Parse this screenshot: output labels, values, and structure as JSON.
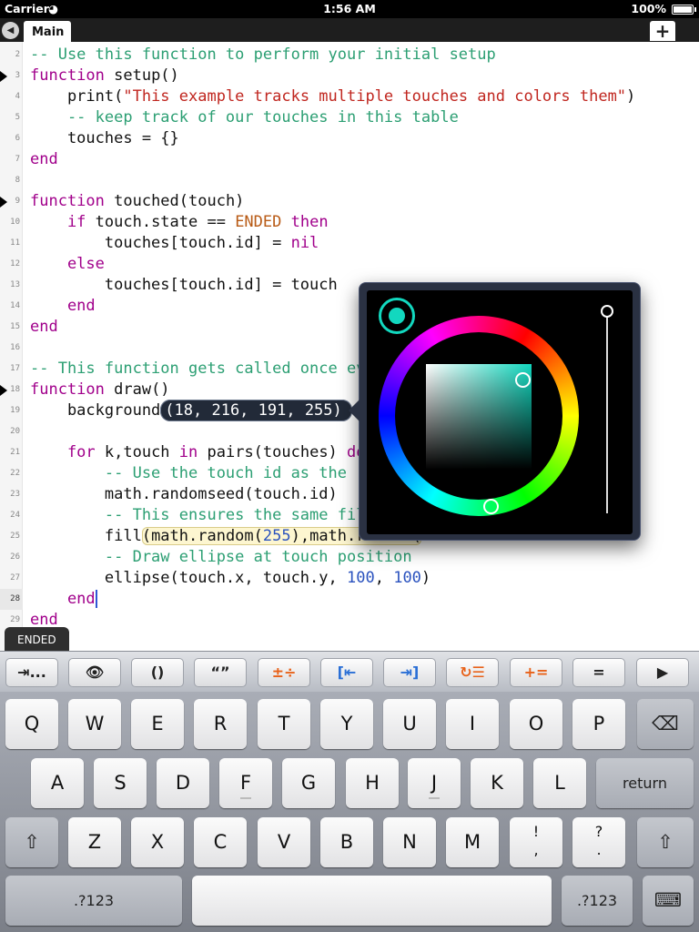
{
  "status_bar": {
    "carrier": "Carrier",
    "wifi_icon": "◕",
    "time": "1:56 AM",
    "battery": "100%"
  },
  "tabs": {
    "back_icon": "◀",
    "active_tab": "Main",
    "add_label": "+"
  },
  "lines": [
    {
      "n": "2"
    },
    {
      "n": "3",
      "bp": true
    },
    {
      "n": "4"
    },
    {
      "n": "5"
    },
    {
      "n": "6"
    },
    {
      "n": "7"
    },
    {
      "n": "8"
    },
    {
      "n": "9",
      "bp": true
    },
    {
      "n": "10"
    },
    {
      "n": "11"
    },
    {
      "n": "12"
    },
    {
      "n": "13"
    },
    {
      "n": "14"
    },
    {
      "n": "15"
    },
    {
      "n": "16"
    },
    {
      "n": "17"
    },
    {
      "n": "18",
      "bp": true
    },
    {
      "n": "19"
    },
    {
      "n": "20"
    },
    {
      "n": "21"
    },
    {
      "n": "22"
    },
    {
      "n": "23"
    },
    {
      "n": "24"
    },
    {
      "n": "25"
    },
    {
      "n": "26"
    },
    {
      "n": "27"
    },
    {
      "n": "28",
      "active": true
    },
    {
      "n": "29"
    }
  ],
  "code": {
    "l2": "-- Use this function to perform your initial setup",
    "l3_kw": "function",
    "l3": " setup()",
    "l4_a": "    print(",
    "l4_str": "\"This example tracks multiple touches and colors them\"",
    "l4_b": ")",
    "l5": "    -- keep track of our touches in this table",
    "l6": "    touches = {}",
    "l7": "end",
    "l9_kw": "function",
    "l9": " touched(touch)",
    "l10_if": "    if",
    "l10_a": " touch.state == ",
    "l10_const": "ENDED",
    "l10_then": " then",
    "l11_a": "        touches[touch.id] = ",
    "l11_nil": "nil",
    "l12": "    else",
    "l13": "        touches[touch.id] = touch",
    "l14": "    end",
    "l15": "end",
    "l17": "-- This function gets called once ev",
    "l18_kw": "function",
    "l18": " draw()",
    "l19_a": "    background",
    "l19_tuple": "(18, 216, 191, 255)",
    "l21_for": "    for",
    "l21_a": " k,touch ",
    "l21_in": "in",
    "l21_b": " pairs(touches) ",
    "l21_do": "do",
    "l22": "        -- Use the touch id as the r",
    "l23": "        math.randomseed(touch.id)",
    "l24": "        -- This ensures the same fil",
    "l25_a": "        fill",
    "l25_hl_a": "(math.random(",
    "l25_num": "255",
    "l25_hl_b": "),math.random(",
    "l26": "        -- Draw ellipse at touch position",
    "l27_a": "        ellipse(touch.x, touch.y, ",
    "l27_n1": "100",
    "l27_c": ", ",
    "l27_n2": "100",
    "l27_b": ")",
    "l28": "    end",
    "l29": "end"
  },
  "color_picker": {
    "color": "#12d8bf"
  },
  "hint": {
    "label": "ENDED"
  },
  "toolbar": {
    "indent_label": "⇥...",
    "eye_icon": "👁",
    "parens_label": "()",
    "quotes_label": "“”",
    "math_ops_label": "±÷",
    "unindent_label": "[⇤",
    "indent_right_label": "⇥]",
    "format_label": "↻☰",
    "plus_eq_label": "+=",
    "eq_label": "=",
    "run_icon": "▶"
  },
  "keyboard": {
    "row1": [
      "Q",
      "W",
      "E",
      "R",
      "T",
      "Y",
      "U",
      "I",
      "O",
      "P"
    ],
    "backspace_icon": "⌫",
    "row2": [
      "A",
      "S",
      "D",
      "F",
      "G",
      "H",
      "J",
      "K",
      "L"
    ],
    "return_label": "return",
    "shift_icon": "⇧",
    "row3": [
      "Z",
      "X",
      "C",
      "V",
      "B",
      "N",
      "M"
    ],
    "punct1": "!\n,",
    "punct2": "?\n.",
    "numbers_label": ".?123",
    "hide_keyboard_icon": "⌨"
  }
}
